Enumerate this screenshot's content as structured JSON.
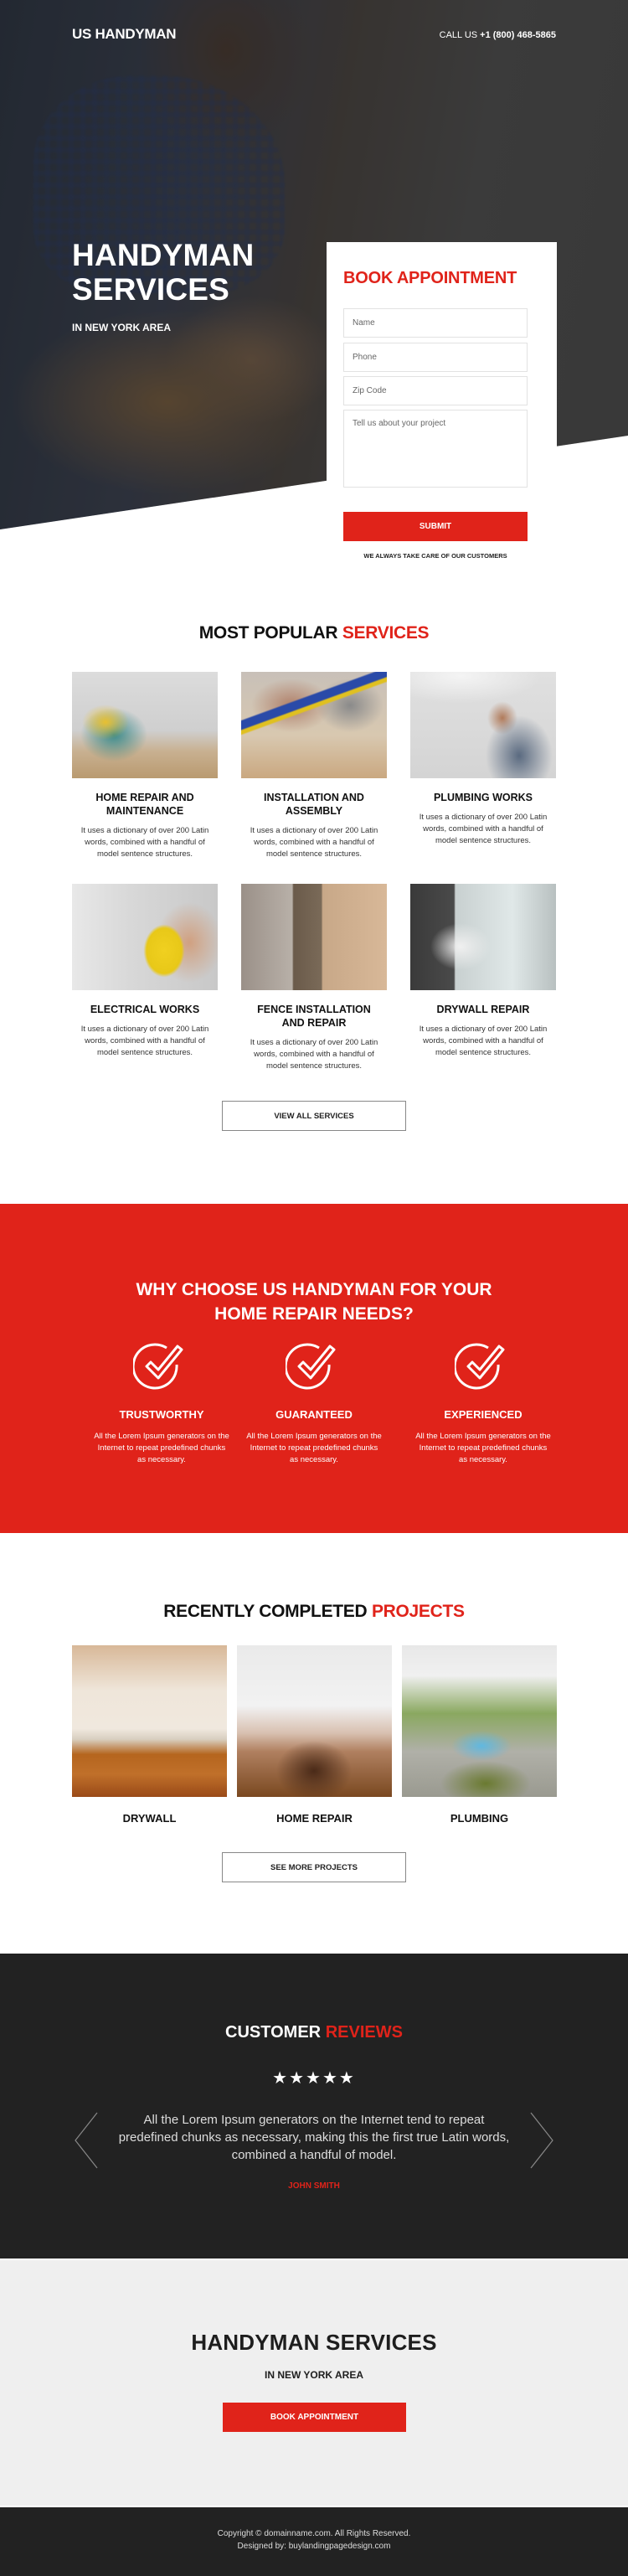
{
  "header": {
    "brand": "US HANDYMAN",
    "call_label": "CALL US",
    "phone": "+1 (800) 468-5865"
  },
  "hero": {
    "title_line1": "HANDYMAN",
    "title_line2": "SERVICES",
    "subtitle": "IN NEW YORK AREA"
  },
  "form": {
    "title": "BOOK APPOINTMENT",
    "name_placeholder": "Name",
    "phone_placeholder": "Phone",
    "zip_placeholder": "Zip Code",
    "project_placeholder": "Tell us about your project",
    "submit_label": "SUBMIT",
    "tagline": "WE ALWAYS TAKE CARE OF OUR CUSTOMERS"
  },
  "services": {
    "title_main": "MOST POPULAR",
    "title_accent": "SERVICES",
    "items": [
      {
        "name": "HOME REPAIR AND MAINTENANCE",
        "desc": "It uses a dictionary of over 200 Latin words, combined with a handful of model sentence structures."
      },
      {
        "name": "INSTALLATION AND ASSEMBLY",
        "desc": "It uses a dictionary of over 200 Latin words, combined with a handful of model sentence structures."
      },
      {
        "name": "PLUMBING WORKS",
        "desc": "It uses a dictionary of over 200 Latin words, combined with a handful of model sentence structures."
      },
      {
        "name": "ELECTRICAL WORKS",
        "desc": "It uses a dictionary of over 200 Latin words, combined with a handful of model sentence structures."
      },
      {
        "name": "FENCE INSTALLATION AND REPAIR",
        "desc": "It uses a dictionary of over 200 Latin words, combined with a handful of model sentence structures."
      },
      {
        "name": "DRYWALL REPAIR",
        "desc": "It uses a dictionary of over 200 Latin words, combined with a handful of model sentence structures."
      }
    ],
    "button_label": "VIEW ALL SERVICES"
  },
  "why": {
    "title_line1": "WHY CHOOSE US HANDYMAN FOR YOUR",
    "title_line2": "HOME REPAIR NEEDS?",
    "features": [
      {
        "icon": "check-circle-icon",
        "name": "TRUSTWORTHY",
        "desc": "All the Lorem Ipsum generators on the Internet to repeat predefined chunks as necessary."
      },
      {
        "icon": "check-circle-icon",
        "name": "GUARANTEED",
        "desc": "All the Lorem Ipsum generators on the Internet to repeat predefined chunks as necessary."
      },
      {
        "icon": "check-circle-icon",
        "name": "EXPERIENCED",
        "desc": "All the Lorem Ipsum generators on the Internet to repeat predefined chunks as necessary."
      }
    ]
  },
  "projects": {
    "title_main": "RECENTLY COMPLETED",
    "title_accent": "PROJECTS",
    "items": [
      {
        "name": "DRYWALL"
      },
      {
        "name": "HOME REPAIR"
      },
      {
        "name": "PLUMBING"
      }
    ],
    "button_label": "SEE MORE PROJECTS"
  },
  "reviews": {
    "title_main": "CUSTOMER",
    "title_accent": "REVIEWS",
    "rating": 5,
    "rating_max": 5,
    "stars": "★★★★★",
    "text": "All the Lorem Ipsum generators on the Internet tend to repeat predefined chunks as necessary, making this the first true Latin words, combined a handful of model.",
    "author": "JOHN SMITH"
  },
  "cta": {
    "title": "HANDYMAN SERVICES",
    "subtitle": "IN NEW YORK AREA",
    "button_label": "BOOK APPOINTMENT"
  },
  "footer": {
    "copyright": "Copyright © domainname.com. All Rights Reserved.",
    "designed_by": "Designed by: buylandingpagedesign.com"
  },
  "colors": {
    "accent": "#e0231a",
    "dark": "#222222",
    "light": "#efefef"
  }
}
